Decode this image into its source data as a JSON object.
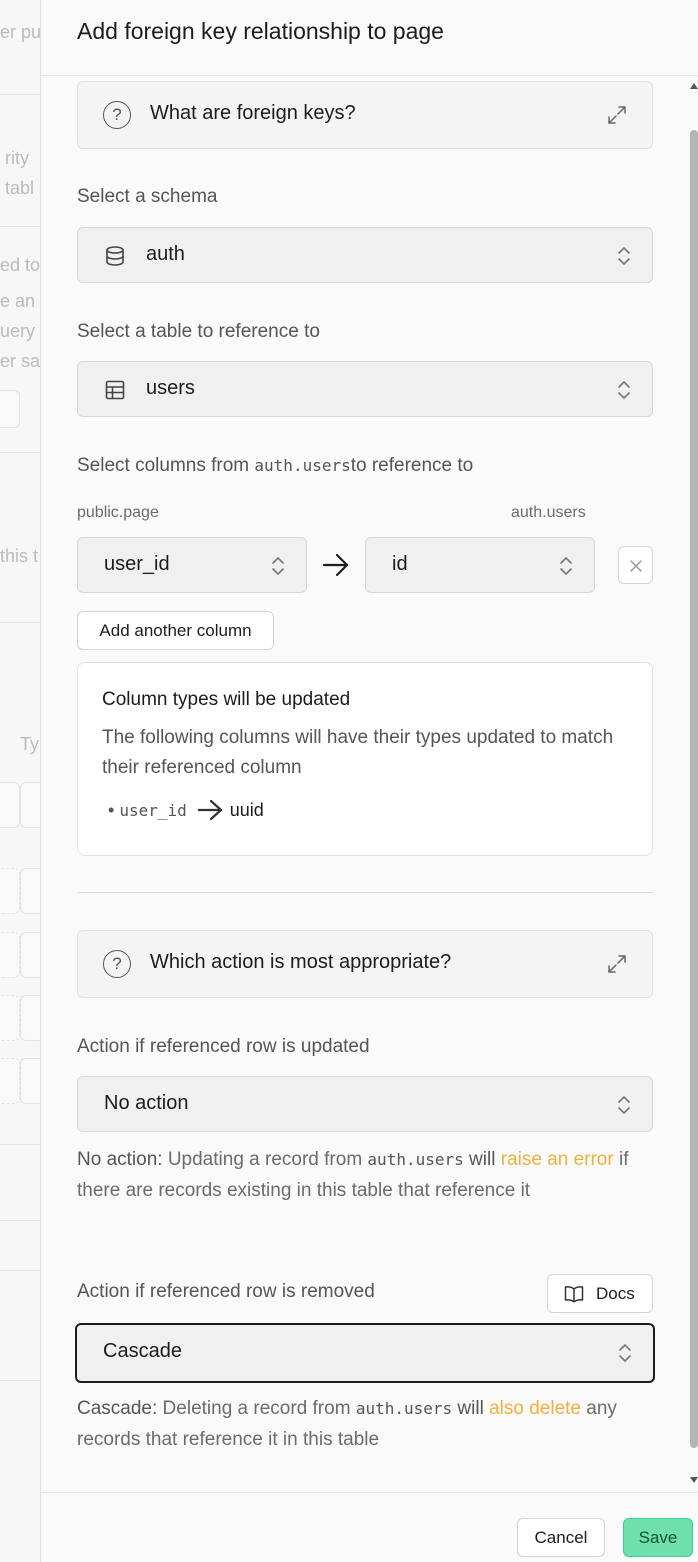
{
  "background": {
    "fragments": [
      "er pu",
      "rity",
      "tabl",
      "ed to",
      "e an a",
      "uery",
      "er sa",
      "this t",
      "Ty"
    ]
  },
  "panel": {
    "title": "Add foreign key relationship to page"
  },
  "fk_help": {
    "label": "What are foreign keys?"
  },
  "schema": {
    "label": "Select a schema",
    "value": "auth",
    "icon": "database-icon"
  },
  "table": {
    "label": "Select a table to reference to",
    "value": "users",
    "icon": "table-icon"
  },
  "columns": {
    "label_prefix": "Select columns from ",
    "label_code": "auth.users",
    "label_suffix": "to reference to",
    "source_table": "public.page",
    "target_table": "auth.users",
    "source_column": "user_id",
    "target_column": "id",
    "add_button": "Add another column"
  },
  "type_notice": {
    "title": "Column types will be updated",
    "description": "The following columns will have their types updated to match their referenced column",
    "item_column": "user_id",
    "item_type": "uuid"
  },
  "action_help": {
    "label": "Which action is most appropriate?"
  },
  "on_update": {
    "label": "Action if referenced row is updated",
    "value": "No action",
    "help_key": "No action:",
    "help_text1": " Updating a record from ",
    "help_code": "auth.users",
    "help_text2": " will ",
    "help_warn": "raise an error",
    "help_text3": " if there are records existing in this table that reference it"
  },
  "on_delete": {
    "label": "Action if referenced row is removed",
    "docs_label": "Docs",
    "value": "Cascade",
    "help_key": "Cascade:",
    "help_text1": " Deleting a record from ",
    "help_code": "auth.users",
    "help_text2": " will ",
    "help_warn": "also delete",
    "help_text3": " any records that reference it in this table"
  },
  "footer": {
    "cancel_label": "Cancel",
    "save_label": "Save"
  },
  "colors": {
    "accent": "#3ecf8e",
    "warning": "#f0b13a"
  }
}
